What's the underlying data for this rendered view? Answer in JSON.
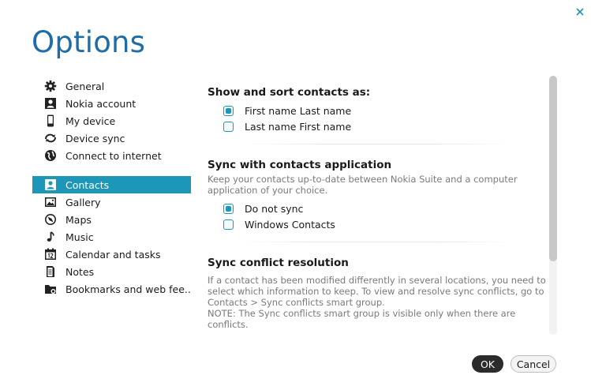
{
  "window": {
    "title": "Options",
    "close_icon": "close-icon"
  },
  "sidebar": {
    "group1": [
      {
        "label": "General",
        "icon": "gear-icon"
      },
      {
        "label": "Nokia account",
        "icon": "person-icon"
      },
      {
        "label": "My device",
        "icon": "phone-icon"
      },
      {
        "label": "Device sync",
        "icon": "sync-icon"
      },
      {
        "label": "Connect to internet",
        "icon": "globe-icon"
      }
    ],
    "group2": [
      {
        "label": "Contacts",
        "icon": "contacts-icon",
        "selected": true
      },
      {
        "label": "Gallery",
        "icon": "image-icon"
      },
      {
        "label": "Maps",
        "icon": "compass-icon"
      },
      {
        "label": "Music",
        "icon": "music-note-icon"
      },
      {
        "label": "Calendar and tasks",
        "icon": "calendar-icon"
      },
      {
        "label": "Notes",
        "icon": "notes-icon"
      },
      {
        "label": "Bookmarks and web fee...",
        "icon": "bookmark-folder-icon"
      }
    ]
  },
  "content": {
    "sort_section": {
      "title": "Show and sort contacts as:",
      "options": [
        {
          "label": "First name Last name",
          "checked": true
        },
        {
          "label": "Last name First name",
          "checked": false
        }
      ]
    },
    "sync_section": {
      "title": "Sync with contacts application",
      "description": "Keep your contacts up-to-date between Nokia Suite and a computer application of your choice.",
      "options": [
        {
          "label": "Do not sync",
          "checked": true
        },
        {
          "label": "Windows Contacts",
          "checked": false
        }
      ]
    },
    "conflict_section": {
      "title": "Sync conflict resolution",
      "description": "If a contact has been modified differently in several locations, you need to select which information to keep. To view and resolve sync conflicts, go to Contacts > Sync conflicts smart group.",
      "note": "NOTE: The Sync conflicts smart group is visible only when there are conflicts."
    }
  },
  "buttons": {
    "ok": "OK",
    "cancel": "Cancel"
  },
  "colors": {
    "accent": "#1d97b8",
    "title": "#1f6da8"
  }
}
